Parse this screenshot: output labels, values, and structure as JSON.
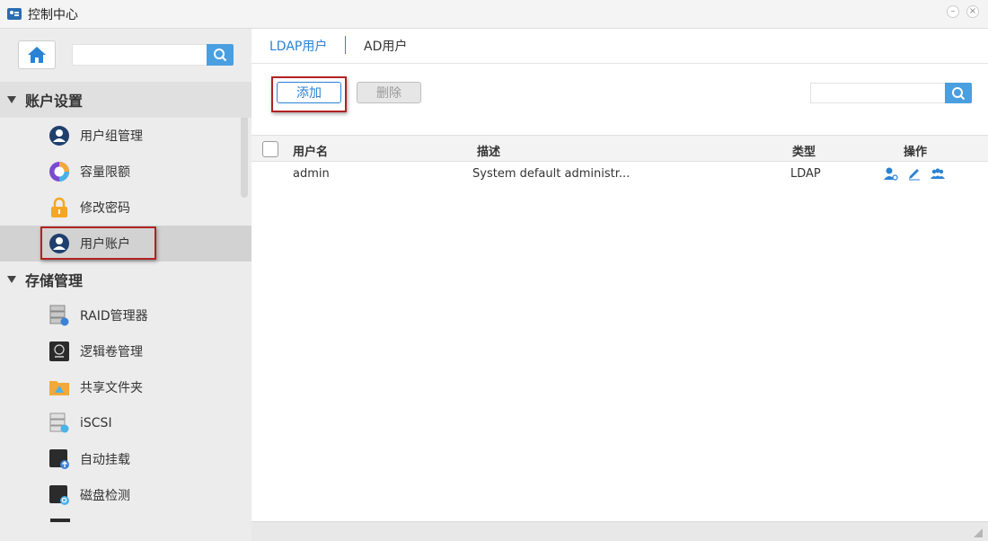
{
  "window": {
    "title": "控制中心",
    "min_icon": "minimize-icon",
    "close_icon": "close-icon"
  },
  "sidebar": {
    "search": {
      "value": "",
      "placeholder": ""
    },
    "groups": [
      {
        "label": "账户设置",
        "items": [
          {
            "label": "用户组管理",
            "icon": "user-group-icon"
          },
          {
            "label": "容量限额",
            "icon": "quota-icon"
          },
          {
            "label": "修改密码",
            "icon": "lock-icon"
          },
          {
            "label": "用户账户",
            "icon": "user-account-icon",
            "active": true
          }
        ]
      },
      {
        "label": "存储管理",
        "items": [
          {
            "label": "RAID管理器",
            "icon": "raid-icon"
          },
          {
            "label": "逻辑卷管理",
            "icon": "lvm-icon"
          },
          {
            "label": "共享文件夹",
            "icon": "shared-folder-icon"
          },
          {
            "label": "iSCSI",
            "icon": "iscsi-icon"
          },
          {
            "label": "自动挂载",
            "icon": "automount-icon"
          },
          {
            "label": "磁盘检测",
            "icon": "disk-check-icon"
          }
        ]
      }
    ]
  },
  "main": {
    "tabs": [
      {
        "label": "LDAP用户",
        "active": true
      },
      {
        "label": "AD用户",
        "active": false
      }
    ],
    "toolbar": {
      "add_label": "添加",
      "delete_label": "删除"
    },
    "search": {
      "value": "",
      "placeholder": ""
    },
    "table": {
      "columns": [
        "用户名",
        "描述",
        "类型",
        "操作"
      ],
      "rows": [
        {
          "username": "admin",
          "description": "System default administr...",
          "type": "LDAP"
        }
      ]
    }
  },
  "colors": {
    "accent": "#2a82d5",
    "search_button": "#4a9fe0",
    "highlight": "#b22222"
  }
}
